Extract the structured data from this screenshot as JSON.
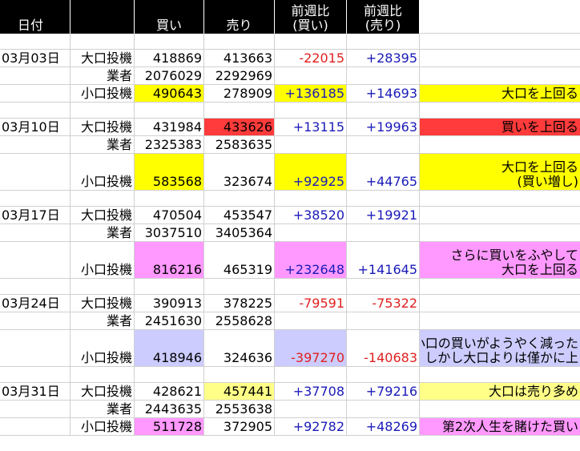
{
  "headers": {
    "date": "日付",
    "blank": "",
    "buy": "買い",
    "sell": "売り",
    "wow_buy": [
      "前週比",
      "(買い)"
    ],
    "wow_sell": [
      "前週比",
      "(売り)"
    ]
  },
  "colors": {
    "yellow": "#ffff00",
    "red": "#ff3b3b",
    "pink": "#ff99ff",
    "lavender": "#ccccff",
    "light_yellow": "#ffff88",
    "neg_text": "#e02020",
    "pos_text": "#1a1ab8"
  },
  "weeks": [
    {
      "date": "03月03日",
      "rows": [
        {
          "type": "大口投機",
          "buy": "418869",
          "sell": "413663",
          "wow_buy": "-22015",
          "wow_sell": "+28395",
          "note": []
        },
        {
          "type": "業者",
          "buy": "2076029",
          "sell": "2292969",
          "wow_buy": "",
          "wow_sell": "",
          "note": []
        },
        {
          "type": "小口投機",
          "buy": "490643",
          "sell": "278909",
          "wow_buy": "+136185",
          "wow_sell": "+14693",
          "note": [
            "大口を上回る"
          ],
          "buy_bg": "yellow",
          "wow_buy_bg": "yellow",
          "note_bg": "yellow"
        }
      ]
    },
    {
      "date": "03月10日",
      "rows": [
        {
          "type": "大口投機",
          "buy": "431984",
          "sell": "433626",
          "wow_buy": "+13115",
          "wow_sell": "+19963",
          "note": [
            "買いを上回る"
          ],
          "sell_bg": "red",
          "note_bg": "red"
        },
        {
          "type": "業者",
          "buy": "2325383",
          "sell": "2583635",
          "wow_buy": "",
          "wow_sell": "",
          "note": []
        },
        {
          "type": "小口投機",
          "buy": "583568",
          "sell": "323674",
          "wow_buy": "+92925",
          "wow_sell": "+44765",
          "note": [
            "大口を上回る",
            "(買い増し)"
          ],
          "buy_bg": "yellow",
          "wow_buy_bg": "yellow",
          "note_bg": "yellow",
          "tall": true
        }
      ]
    },
    {
      "date": "03月17日",
      "rows": [
        {
          "type": "大口投機",
          "buy": "470504",
          "sell": "453547",
          "wow_buy": "+38520",
          "wow_sell": "+19921",
          "note": []
        },
        {
          "type": "業者",
          "buy": "3037510",
          "sell": "3405364",
          "wow_buy": "",
          "wow_sell": "",
          "note": []
        },
        {
          "type": "小口投機",
          "buy": "816216",
          "sell": "465319",
          "wow_buy": "+232648",
          "wow_sell": "+141645",
          "note": [
            "さらに買いをふやして",
            "大口を上回る"
          ],
          "buy_bg": "pink",
          "wow_buy_bg": "pink",
          "note_bg": "pink",
          "tall": true
        }
      ]
    },
    {
      "date": "03月24日",
      "rows": [
        {
          "type": "大口投機",
          "buy": "390913",
          "sell": "378225",
          "wow_buy": "-79591",
          "wow_sell": "-75322",
          "note": []
        },
        {
          "type": "業者",
          "buy": "2451630",
          "sell": "2558628",
          "wow_buy": "",
          "wow_sell": "",
          "note": []
        },
        {
          "type": "小口投機",
          "buy": "418946",
          "sell": "324636",
          "wow_buy": "-397270",
          "wow_sell": "-140683",
          "note": [
            "小口の買いがようやく減った",
            "しかし大口よりは僅かに上"
          ],
          "buy_bg": "lavender",
          "wow_buy_bg": "lavender",
          "note_bg": "lavender",
          "tall": true
        }
      ]
    },
    {
      "date": "03月31日",
      "rows": [
        {
          "type": "大口投機",
          "buy": "428621",
          "sell": "457441",
          "wow_buy": "+37708",
          "wow_sell": "+79216",
          "note": [
            "大口は売り多め"
          ],
          "sell_bg": "light_yellow",
          "note_bg": "light_yellow"
        },
        {
          "type": "業者",
          "buy": "2443635",
          "sell": "2553638",
          "wow_buy": "",
          "wow_sell": "",
          "note": []
        },
        {
          "type": "小口投機",
          "buy": "511728",
          "sell": "372905",
          "wow_buy": "+92782",
          "wow_sell": "+48269",
          "note": [
            "第2次人生を賭けた買い"
          ],
          "buy_bg": "pink",
          "note_bg": "pink"
        }
      ]
    }
  ]
}
